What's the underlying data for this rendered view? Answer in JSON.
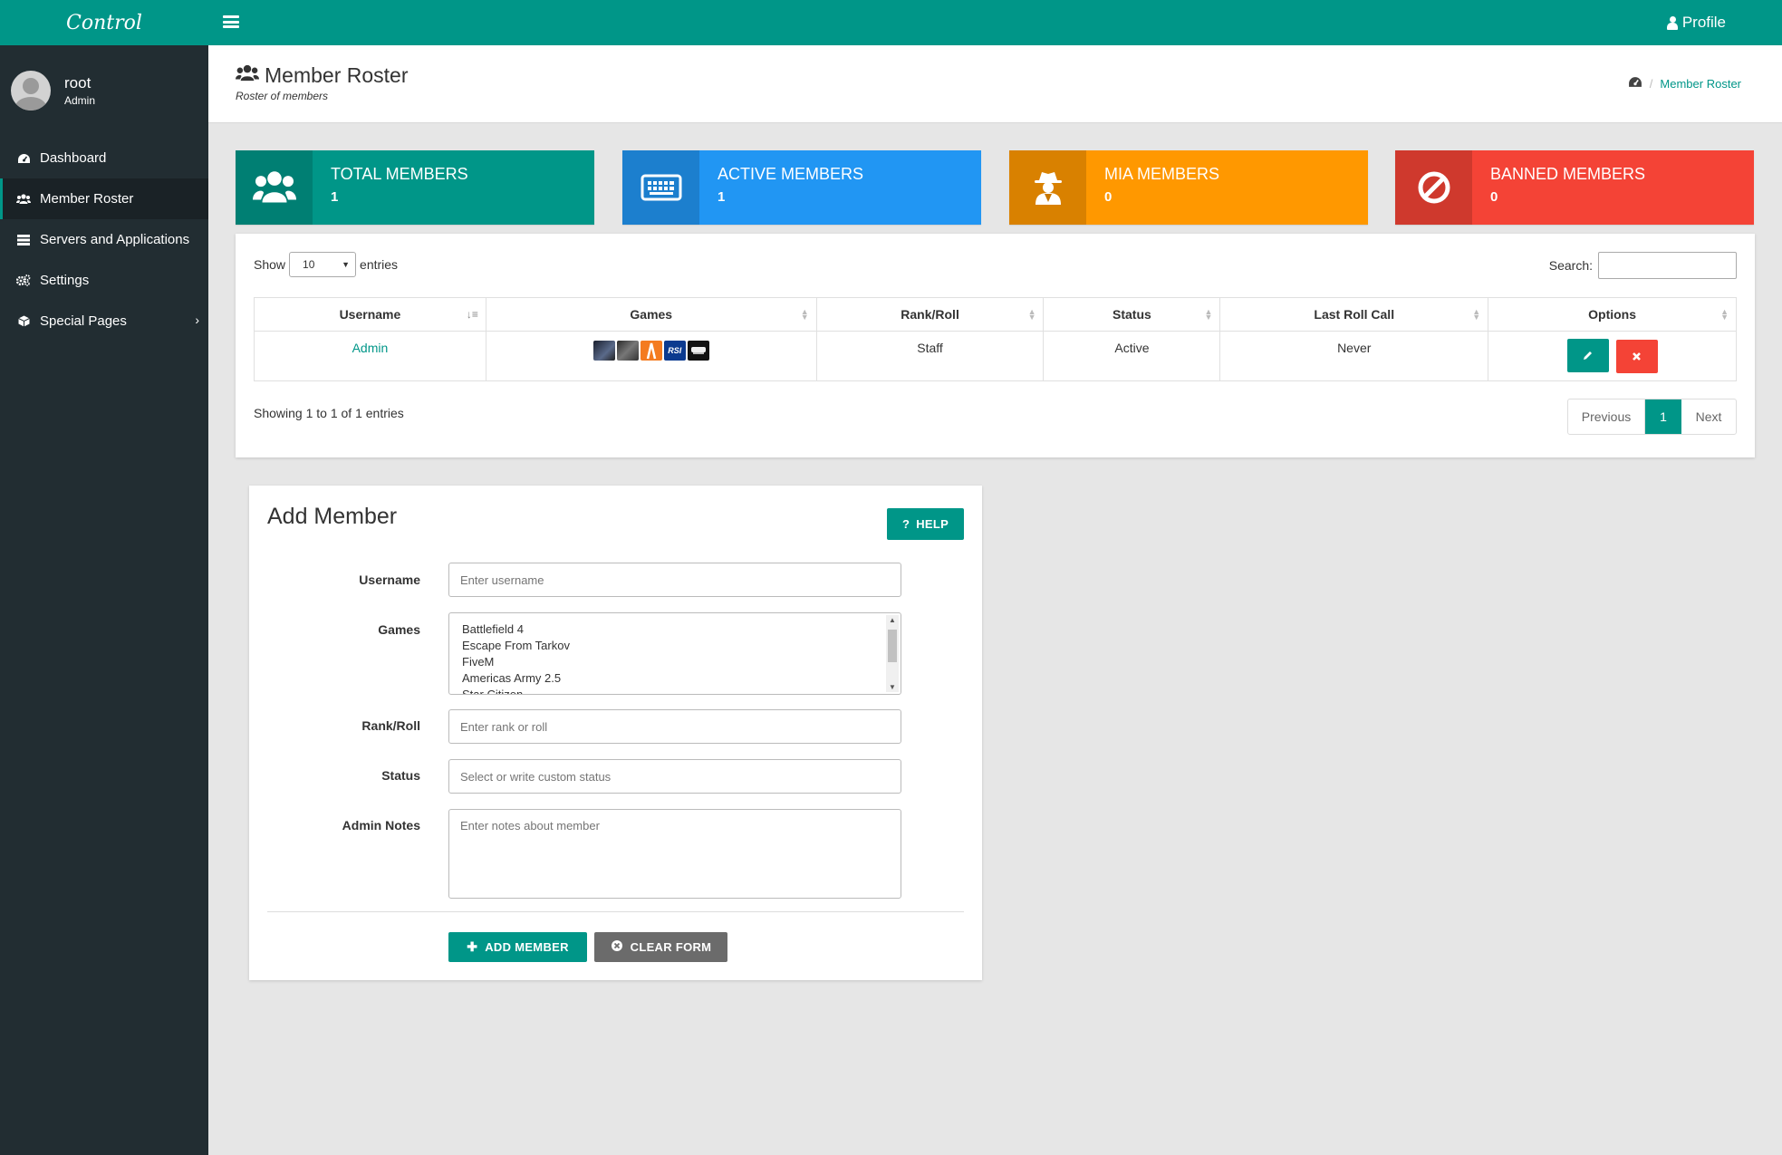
{
  "brand": "Control",
  "user": {
    "name": "root",
    "role": "Admin"
  },
  "nav": [
    {
      "label": "Dashboard",
      "icon": "dashboard-icon",
      "active": false
    },
    {
      "label": "Member Roster",
      "icon": "users-icon",
      "active": true
    },
    {
      "label": "Servers and Applications",
      "icon": "server-icon",
      "active": false
    },
    {
      "label": "Settings",
      "icon": "gears-icon",
      "active": false
    },
    {
      "label": "Special Pages",
      "icon": "cube-icon",
      "active": false
    }
  ],
  "topbar": {
    "profile_label": "Profile"
  },
  "header": {
    "title": "Member Roster",
    "subtitle": "Roster of members",
    "breadcrumb": "Member Roster"
  },
  "stats": [
    {
      "label": "TOTAL MEMBERS",
      "value": "1",
      "color": "#009688",
      "icon": "users-icon"
    },
    {
      "label": "ACTIVE MEMBERS",
      "value": "1",
      "color": "#2196f3",
      "icon": "keyboard-icon"
    },
    {
      "label": "MIA MEMBERS",
      "value": "0",
      "color": "#ff9800",
      "icon": "spy-icon"
    },
    {
      "label": "BANNED MEMBERS",
      "value": "0",
      "color": "#f44336",
      "icon": "ban-icon"
    }
  ],
  "table": {
    "show_label": "Show",
    "length_value": "10",
    "entries_label": "entries",
    "search_label": "Search:",
    "columns": [
      "Username",
      "Games",
      "Rank/Roll",
      "Status",
      "Last Roll Call",
      "Options"
    ],
    "rows": [
      {
        "username": "Admin",
        "rank": "Staff",
        "status": "Active",
        "last_roll_call": "Never"
      }
    ],
    "info": "Showing 1 to 1 of 1 entries",
    "pagination": {
      "previous": "Previous",
      "current": "1",
      "next": "Next"
    }
  },
  "form": {
    "title": "Add Member",
    "help_label": "HELP",
    "fields": {
      "username": {
        "label": "Username",
        "placeholder": "Enter username"
      },
      "games": {
        "label": "Games",
        "options": [
          "Battlefield 4",
          "Escape From Tarkov",
          "FiveM",
          "Americas Army 2.5",
          "Star Citizen"
        ]
      },
      "rank": {
        "label": "Rank/Roll",
        "placeholder": "Enter rank or roll"
      },
      "status": {
        "label": "Status",
        "placeholder": "Select or write custom status"
      },
      "notes": {
        "label": "Admin Notes",
        "placeholder": "Enter notes about member"
      }
    },
    "add_label": "ADD MEMBER",
    "clear_label": "CLEAR FORM"
  },
  "colors": {
    "primary": "#009688",
    "sidebar": "#222d32",
    "danger": "#f44336",
    "gray_button": "#6b6b6b"
  }
}
